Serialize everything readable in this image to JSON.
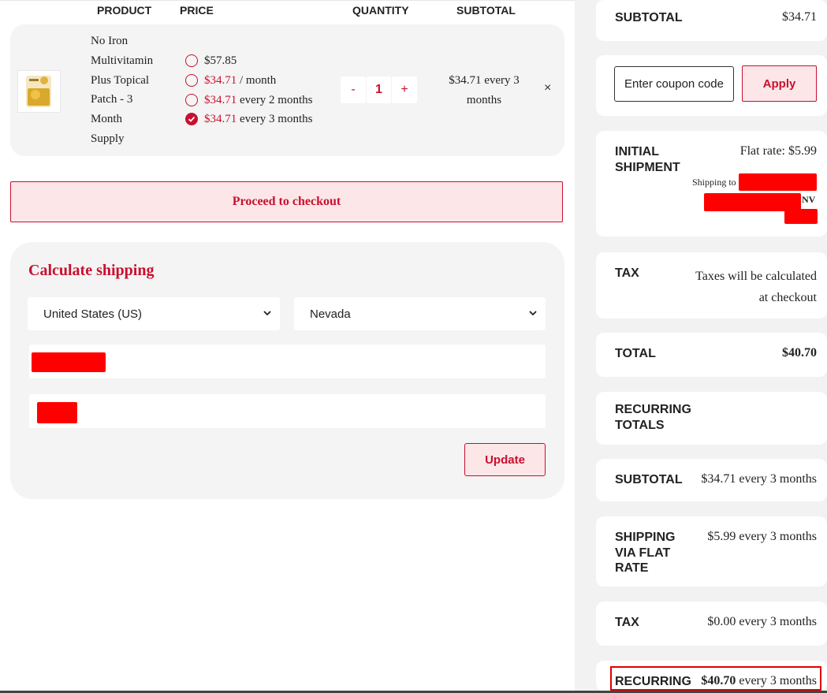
{
  "table_header": {
    "product": "PRODUCT",
    "price": "PRICE",
    "quantity": "QUANTITY",
    "subtotal": "SUBTOTAL"
  },
  "product": {
    "name_lines": [
      "No Iron",
      "Multivitamin",
      "Plus Topical",
      "Patch - 3",
      "Month",
      "Supply"
    ],
    "options": [
      {
        "price": "$57.85",
        "period": "",
        "price_red": false,
        "checked": false
      },
      {
        "price": "$34.71",
        "period": " / month",
        "price_red": true,
        "checked": false
      },
      {
        "price": "$34.71",
        "period": " every 2 months",
        "price_red": true,
        "checked": false
      },
      {
        "price": "$34.71",
        "period": " every 3 months",
        "price_red": true,
        "checked": true
      }
    ],
    "qty_minus": "-",
    "qty_value": "1",
    "qty_plus": "+",
    "subtotal": "$34.71 every 3 months",
    "remove": "×"
  },
  "checkout": {
    "label": "Proceed to checkout"
  },
  "shipping_calc": {
    "title": "Calculate shipping",
    "country": "United States (US)",
    "state": "Nevada",
    "update_label": "Update"
  },
  "totals": {
    "subtotal_label": "SUBTOTAL",
    "subtotal_value": "$34.71",
    "coupon_placeholder": "Enter coupon code",
    "apply_label": "Apply",
    "initial_shipment_line1": "INITIAL",
    "initial_shipment_line2": "SHIPMENT",
    "flat_rate": "Flat rate: $5.99",
    "shipping_to": "Shipping to",
    "shipping_state": "NV",
    "tax_label": "TAX",
    "tax_line1": "Taxes will be calculated",
    "tax_line2": "at checkout",
    "total_label": "TOTAL",
    "total_value": "$40.70",
    "recurring_totals_line1": "RECURRING",
    "recurring_totals_line2": "TOTALS",
    "rec_subtotal_label": "SUBTOTAL",
    "rec_subtotal_value": "$34.71 every 3 months",
    "rec_shipping_line1": "SHIPPING",
    "rec_shipping_line2": "VIA FLAT",
    "rec_shipping_line3": "RATE",
    "rec_shipping_value": "$5.99 every 3 months",
    "rec_tax_label": "TAX",
    "rec_tax_value": "$0.00 every 3 months",
    "rec_total_label": "RECURRING",
    "rec_total_amount": "$40.70",
    "rec_total_period": " every 3 months"
  },
  "colors": {
    "accent": "#c8102e",
    "redaction": "#ff0000",
    "panel_bg": "#f4f4f4"
  }
}
